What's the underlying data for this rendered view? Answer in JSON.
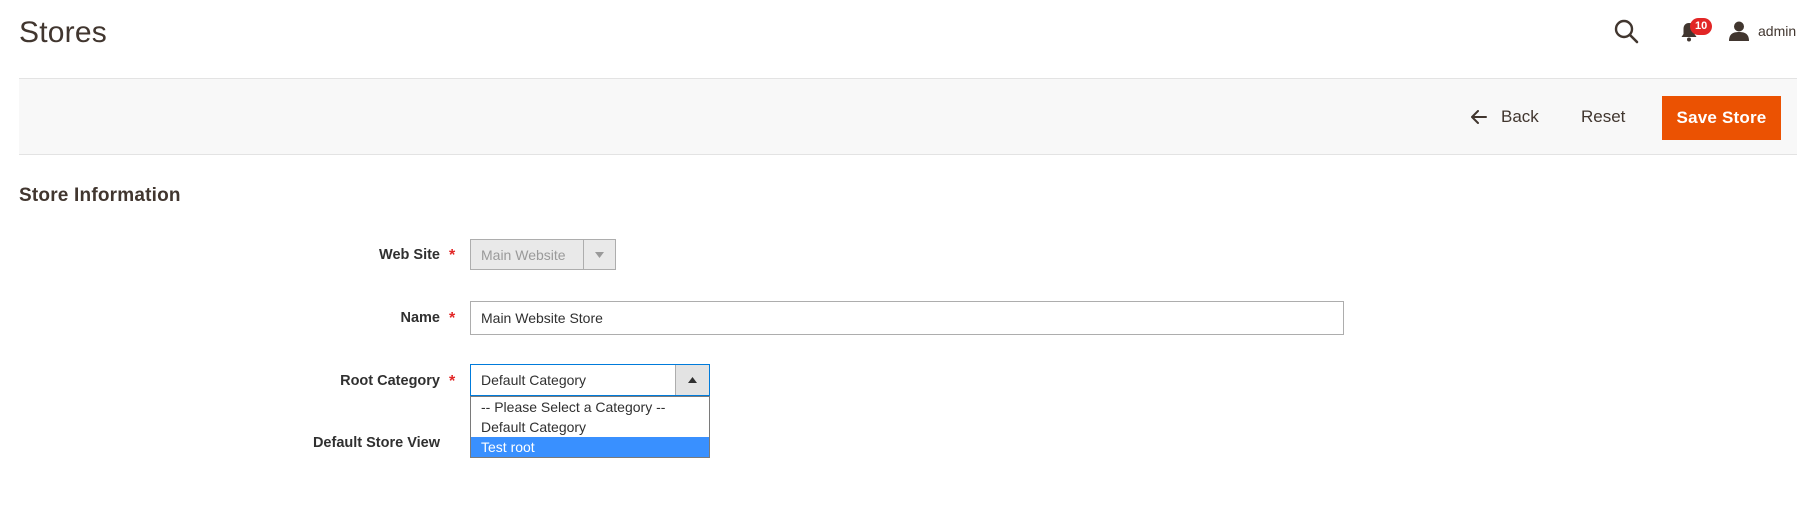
{
  "page": {
    "title": "Stores"
  },
  "header": {
    "notifications_count": "10",
    "user_label": "admin"
  },
  "actions": {
    "back_label": "Back",
    "reset_label": "Reset",
    "save_label": "Save Store"
  },
  "section": {
    "title": "Store Information"
  },
  "form": {
    "website": {
      "label": "Web Site",
      "value": "Main Website",
      "required": true,
      "disabled": true
    },
    "name": {
      "label": "Name",
      "value": "Main Website Store",
      "required": true
    },
    "root_category": {
      "label": "Root Category",
      "value": "Default Category",
      "required": true,
      "options": [
        "-- Please Select a Category --",
        "Default Category",
        "Test root"
      ],
      "highlighted_option": "Test root"
    },
    "default_store_view": {
      "label": "Default Store View"
    }
  },
  "colors": {
    "primary_button": "#eb5202",
    "required_star": "#e22626",
    "badge": "#e22626",
    "focus_border": "#007bdb",
    "option_highlight": "#3990ff"
  },
  "icons": {
    "search": "search-icon",
    "notifications": "bell-icon",
    "user": "user-icon",
    "back": "arrow-left-icon"
  }
}
